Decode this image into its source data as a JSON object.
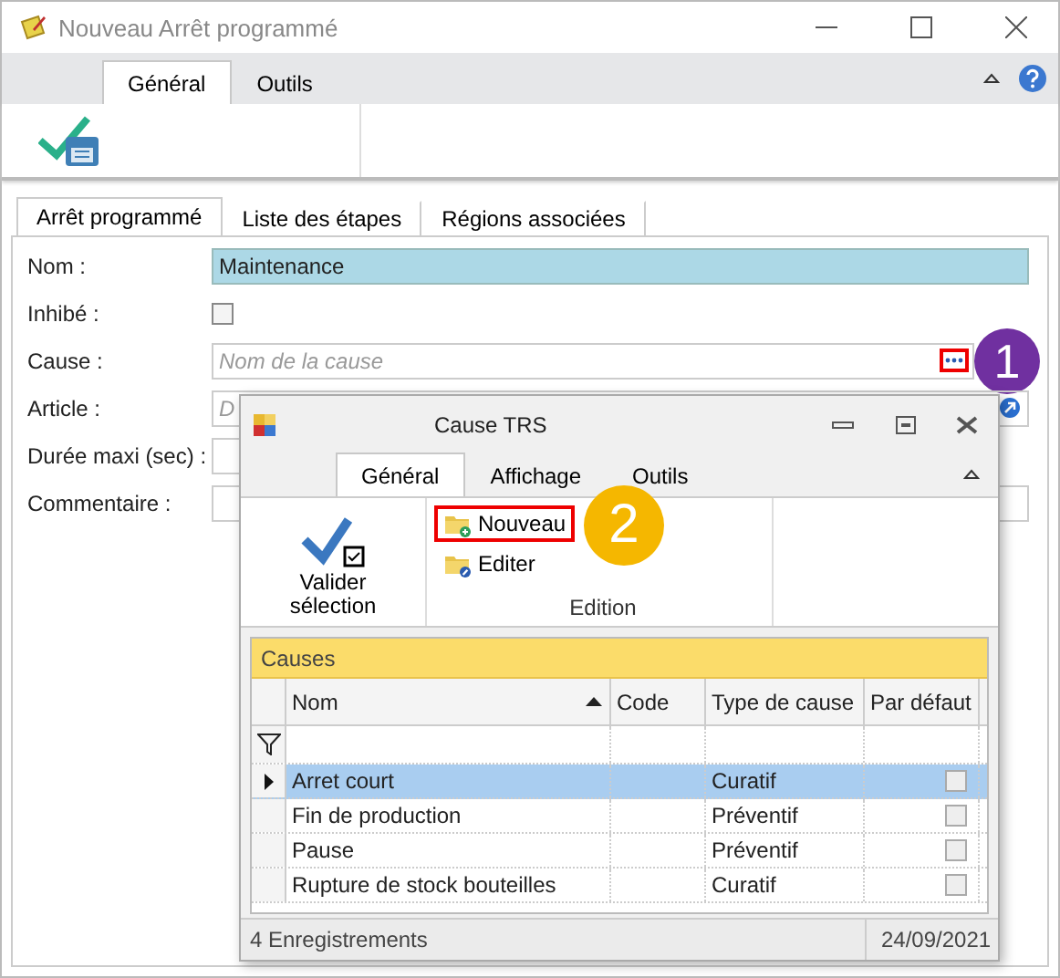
{
  "window": {
    "title": "Nouveau Arrêt programmé"
  },
  "ribbon": {
    "tabs": [
      {
        "label": "Général",
        "selected": true
      },
      {
        "label": "Outils",
        "selected": false
      }
    ]
  },
  "form_tabs": [
    {
      "label": "Arrêt programmé",
      "selected": true
    },
    {
      "label": "Liste des étapes",
      "selected": false
    },
    {
      "label": "Régions associées",
      "selected": false
    }
  ],
  "fields": [
    {
      "kind": "text",
      "label": "Nom :",
      "value": "Maintenance",
      "selected": true
    },
    {
      "kind": "checkbox",
      "label": "Inhibé :",
      "checked": false
    },
    {
      "kind": "lookup",
      "label": "Cause :",
      "placeholder": "Nom de la cause",
      "highlighted": true,
      "callout": {
        "label": "1",
        "color": "#7030a0"
      }
    },
    {
      "kind": "link",
      "label": "Article :",
      "placeholder": "D"
    },
    {
      "kind": "short",
      "label": "Durée maxi (sec) :"
    },
    {
      "kind": "text",
      "label": "Commentaire :"
    }
  ],
  "dialog": {
    "title": "Cause TRS",
    "tabs": [
      {
        "label": "Général",
        "selected": true
      },
      {
        "label": "Affichage",
        "selected": false
      },
      {
        "label": "Outils",
        "selected": false
      }
    ],
    "validate": "Valider sélection",
    "actions": [
      {
        "kind": "new",
        "label": "Nouveau",
        "highlighted": true,
        "callout": {
          "label": "2",
          "color": "#f5b700"
        }
      },
      {
        "kind": "edit",
        "label": "Editer",
        "highlighted": false
      }
    ],
    "group": "Edition",
    "grid": {
      "title": "Causes",
      "columns": [
        {
          "label": "Nom",
          "sorted": true
        },
        {
          "label": "Code",
          "sorted": false
        },
        {
          "label": "Type de cause",
          "sorted": false
        },
        {
          "label": "Par défaut",
          "sorted": false
        }
      ],
      "rows": [
        {
          "name": "Arret court",
          "type": "Curatif",
          "default": false,
          "selected": true
        },
        {
          "name": "Fin de production",
          "type": "Préventif",
          "default": false,
          "selected": false
        },
        {
          "name": "Pause",
          "type": "Préventif",
          "default": false,
          "selected": false
        },
        {
          "name": "Rupture de stock bouteilles",
          "type": "Curatif",
          "default": false,
          "selected": false
        }
      ]
    },
    "status": {
      "count": "4 Enregistrements",
      "date": "24/09/2021"
    }
  }
}
